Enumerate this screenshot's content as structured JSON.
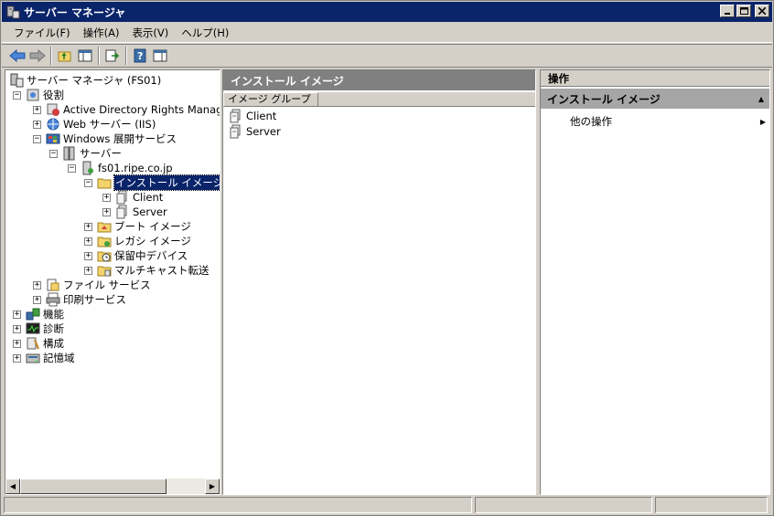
{
  "window": {
    "title": "サーバー マネージャ"
  },
  "menu": [
    "ファイル(F)",
    "操作(A)",
    "表示(V)",
    "ヘルプ(H)"
  ],
  "tree": [
    {
      "id": "root",
      "label": "サーバー マネージャ (FS01)",
      "level": 0,
      "icon": "server-manager-icon",
      "expander": ""
    },
    {
      "id": "roles",
      "label": "役割",
      "level": 1,
      "icon": "roles-icon",
      "expander": "−"
    },
    {
      "id": "adrms",
      "label": "Active Directory Rights Manager",
      "level": 2,
      "icon": "adrms-icon",
      "expander": "+"
    },
    {
      "id": "iis",
      "label": "Web サーバー (IIS)",
      "level": 2,
      "icon": "web-server-icon",
      "expander": "+"
    },
    {
      "id": "wds",
      "label": "Windows 展開サービス",
      "level": 2,
      "icon": "wds-icon",
      "expander": "−"
    },
    {
      "id": "servers",
      "label": "サーバー",
      "level": 3,
      "icon": "servers-icon",
      "expander": "−"
    },
    {
      "id": "fs01",
      "label": "fs01.ripe.co.jp",
      "level": 4,
      "icon": "server-icon",
      "expander": "−"
    },
    {
      "id": "install-images",
      "label": "インストール イメージ",
      "level": 5,
      "icon": "folder-icon",
      "expander": "−",
      "selected": true
    },
    {
      "id": "client",
      "label": "Client",
      "level": 6,
      "icon": "image-group-icon",
      "expander": "+"
    },
    {
      "id": "server",
      "label": "Server",
      "level": 6,
      "icon": "image-group-icon",
      "expander": "+"
    },
    {
      "id": "boot-images",
      "label": "ブート イメージ",
      "level": 5,
      "icon": "boot-image-icon",
      "expander": "+"
    },
    {
      "id": "legacy-images",
      "label": "レガシ イメージ",
      "level": 5,
      "icon": "legacy-image-icon",
      "expander": "+"
    },
    {
      "id": "pending-devices",
      "label": "保留中デバイス",
      "level": 5,
      "icon": "pending-device-icon",
      "expander": "+"
    },
    {
      "id": "multicast",
      "label": "マルチキャスト転送",
      "level": 5,
      "icon": "multicast-icon",
      "expander": "+"
    },
    {
      "id": "file-services",
      "label": "ファイル サービス",
      "level": 2,
      "icon": "file-services-icon",
      "expander": "+"
    },
    {
      "id": "print-services",
      "label": "印刷サービス",
      "level": 2,
      "icon": "print-services-icon",
      "expander": "+"
    },
    {
      "id": "features",
      "label": "機能",
      "level": 1,
      "icon": "features-icon",
      "expander": "+"
    },
    {
      "id": "diagnostics",
      "label": "診断",
      "level": 1,
      "icon": "diagnostics-icon",
      "expander": "+"
    },
    {
      "id": "configuration",
      "label": "構成",
      "level": 1,
      "icon": "configuration-icon",
      "expander": "+"
    },
    {
      "id": "storage",
      "label": "記憶域",
      "level": 1,
      "icon": "storage-icon",
      "expander": "+"
    }
  ],
  "center": {
    "title": "インストール イメージ",
    "column": "イメージ グループ",
    "items": [
      "Client",
      "Server"
    ]
  },
  "actions": {
    "title": "操作",
    "section": "インストール イメージ",
    "items": [
      "他の操作"
    ]
  },
  "colors": {
    "titlebar": "#0a246a",
    "selection": "#0a246a",
    "pane_header": "#808080",
    "action_section": "#a6a6a6"
  }
}
